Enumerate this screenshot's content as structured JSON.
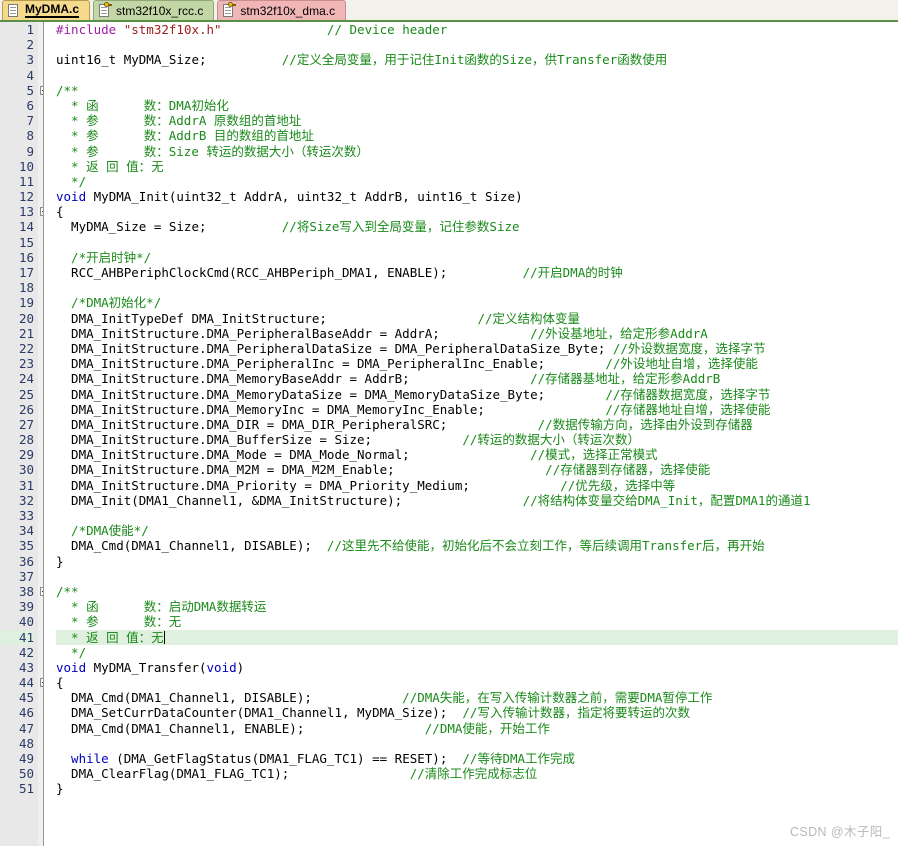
{
  "tabs": [
    {
      "label": "MyDMA.c",
      "state": "active",
      "icon": "document-icon"
    },
    {
      "label": "stm32f10x_rcc.c",
      "state": "green",
      "icon": "document-key-icon"
    },
    {
      "label": "stm32f10x_dma.c",
      "state": "pink",
      "icon": "document-key-icon"
    }
  ],
  "colors": {
    "active_tab": "#f5d98c",
    "green_tab": "#c3d6a6",
    "pink_tab": "#f0b5b5",
    "tabbar_rule": "#5a8f4a",
    "gutter_bg": "#e8e8e8",
    "line_number": "#2b3a67",
    "comment": "#1a8a1a",
    "keyword": "#0000c0",
    "preprocessor": "#a020a0",
    "string": "#a02020",
    "current_line": "#dff0df",
    "watermark": "#b9b9b9"
  },
  "editor": {
    "current_line": 41,
    "first_line": 1,
    "last_line": 51,
    "lines": [
      {
        "n": 1,
        "fold": "none",
        "tokens": [
          {
            "c": "t-pre",
            "s": "#include "
          },
          {
            "c": "t-str",
            "s": "\"stm32f10x.h\""
          },
          {
            "c": "t-cmt",
            "s": "              // Device header"
          }
        ]
      },
      {
        "n": 2,
        "fold": "none",
        "tokens": []
      },
      {
        "n": 3,
        "fold": "none",
        "tokens": [
          {
            "c": "t-txt",
            "s": "uint16_t MyDMA_Size;"
          },
          {
            "c": "t-cmt",
            "s": "          //定义全局变量，用于记住Init函数的Size，供Transfer函数使用"
          }
        ]
      },
      {
        "n": 4,
        "fold": "none",
        "tokens": []
      },
      {
        "n": 5,
        "fold": "start",
        "tokens": [
          {
            "c": "t-cmt",
            "s": "/**"
          }
        ]
      },
      {
        "n": 6,
        "fold": "bar",
        "tokens": [
          {
            "c": "t-cmt",
            "s": "  * 函      数：DMA初始化"
          }
        ]
      },
      {
        "n": 7,
        "fold": "bar",
        "tokens": [
          {
            "c": "t-cmt",
            "s": "  * 参      数：AddrA 原数组的首地址"
          }
        ]
      },
      {
        "n": 8,
        "fold": "bar",
        "tokens": [
          {
            "c": "t-cmt",
            "s": "  * 参      数：AddrB 目的数组的首地址"
          }
        ]
      },
      {
        "n": 9,
        "fold": "bar",
        "tokens": [
          {
            "c": "t-cmt",
            "s": "  * 参      数：Size 转运的数据大小（转运次数）"
          }
        ]
      },
      {
        "n": 10,
        "fold": "bar",
        "tokens": [
          {
            "c": "t-cmt",
            "s": "  * 返 回 值：无"
          }
        ]
      },
      {
        "n": 11,
        "fold": "end",
        "tokens": [
          {
            "c": "t-cmt",
            "s": "  */"
          }
        ]
      },
      {
        "n": 12,
        "fold": "none",
        "tokens": [
          {
            "c": "t-kw",
            "s": "void "
          },
          {
            "c": "t-txt",
            "s": "MyDMA_Init(uint32_t AddrA, uint32_t AddrB, uint16_t Size)"
          }
        ]
      },
      {
        "n": 13,
        "fold": "start",
        "tokens": [
          {
            "c": "t-txt",
            "s": "{"
          }
        ]
      },
      {
        "n": 14,
        "fold": "bar",
        "tokens": [
          {
            "c": "t-txt",
            "s": "  MyDMA_Size = Size;"
          },
          {
            "c": "t-cmt",
            "s": "          //将Size写入到全局变量，记住参数Size"
          }
        ]
      },
      {
        "n": 15,
        "fold": "bar",
        "tokens": []
      },
      {
        "n": 16,
        "fold": "bar",
        "tokens": [
          {
            "c": "t-cmt",
            "s": "  /*开启时钟*/"
          }
        ]
      },
      {
        "n": 17,
        "fold": "bar",
        "tokens": [
          {
            "c": "t-txt",
            "s": "  RCC_AHBPeriphClockCmd(RCC_AHBPeriph_DMA1, ENABLE);"
          },
          {
            "c": "t-cmt",
            "s": "          //开启DMA的时钟"
          }
        ]
      },
      {
        "n": 18,
        "fold": "bar",
        "tokens": []
      },
      {
        "n": 19,
        "fold": "bar",
        "tokens": [
          {
            "c": "t-cmt",
            "s": "  /*DMA初始化*/"
          }
        ]
      },
      {
        "n": 20,
        "fold": "bar",
        "tokens": [
          {
            "c": "t-txt",
            "s": "  DMA_InitTypeDef DMA_InitStructure;"
          },
          {
            "c": "t-cmt",
            "s": "                    //定义结构体变量"
          }
        ]
      },
      {
        "n": 21,
        "fold": "bar",
        "tokens": [
          {
            "c": "t-txt",
            "s": "  DMA_InitStructure.DMA_PeripheralBaseAddr = AddrA;"
          },
          {
            "c": "t-cmt",
            "s": "            //外设基地址，给定形参AddrA"
          }
        ]
      },
      {
        "n": 22,
        "fold": "bar",
        "tokens": [
          {
            "c": "t-txt",
            "s": "  DMA_InitStructure.DMA_PeripheralDataSize = DMA_PeripheralDataSize_Byte;"
          },
          {
            "c": "t-cmt",
            "s": " //外设数据宽度，选择字节"
          }
        ]
      },
      {
        "n": 23,
        "fold": "bar",
        "tokens": [
          {
            "c": "t-txt",
            "s": "  DMA_InitStructure.DMA_PeripheralInc = DMA_PeripheralInc_Enable;"
          },
          {
            "c": "t-cmt",
            "s": "        //外设地址自增，选择使能"
          }
        ]
      },
      {
        "n": 24,
        "fold": "bar",
        "tokens": [
          {
            "c": "t-txt",
            "s": "  DMA_InitStructure.DMA_MemoryBaseAddr = AddrB;"
          },
          {
            "c": "t-cmt",
            "s": "                //存储器基地址，给定形参AddrB"
          }
        ]
      },
      {
        "n": 25,
        "fold": "bar",
        "tokens": [
          {
            "c": "t-txt",
            "s": "  DMA_InitStructure.DMA_MemoryDataSize = DMA_MemoryDataSize_Byte;"
          },
          {
            "c": "t-cmt",
            "s": "        //存储器数据宽度，选择字节"
          }
        ]
      },
      {
        "n": 26,
        "fold": "bar",
        "tokens": [
          {
            "c": "t-txt",
            "s": "  DMA_InitStructure.DMA_MemoryInc = DMA_MemoryInc_Enable;"
          },
          {
            "c": "t-cmt",
            "s": "                //存储器地址自增，选择使能"
          }
        ]
      },
      {
        "n": 27,
        "fold": "bar",
        "tokens": [
          {
            "c": "t-txt",
            "s": "  DMA_InitStructure.DMA_DIR = DMA_DIR_PeripheralSRC;"
          },
          {
            "c": "t-cmt",
            "s": "            //数据传输方向，选择由外设到存储器"
          }
        ]
      },
      {
        "n": 28,
        "fold": "bar",
        "tokens": [
          {
            "c": "t-txt",
            "s": "  DMA_InitStructure.DMA_BufferSize = Size;"
          },
          {
            "c": "t-cmt",
            "s": "            //转运的数据大小（转运次数）"
          }
        ]
      },
      {
        "n": 29,
        "fold": "bar",
        "tokens": [
          {
            "c": "t-txt",
            "s": "  DMA_InitStructure.DMA_Mode = DMA_Mode_Normal;"
          },
          {
            "c": "t-cmt",
            "s": "                //模式，选择正常模式"
          }
        ]
      },
      {
        "n": 30,
        "fold": "bar",
        "tokens": [
          {
            "c": "t-txt",
            "s": "  DMA_InitStructure.DMA_M2M = DMA_M2M_Enable;"
          },
          {
            "c": "t-cmt",
            "s": "                    //存储器到存储器，选择使能"
          }
        ]
      },
      {
        "n": 31,
        "fold": "bar",
        "tokens": [
          {
            "c": "t-txt",
            "s": "  DMA_InitStructure.DMA_Priority = DMA_Priority_Medium;"
          },
          {
            "c": "t-cmt",
            "s": "            //优先级，选择中等"
          }
        ]
      },
      {
        "n": 32,
        "fold": "bar",
        "tokens": [
          {
            "c": "t-txt",
            "s": "  DMA_Init(DMA1_Channel1, &DMA_InitStructure);"
          },
          {
            "c": "t-cmt",
            "s": "                //将结构体变量交给DMA_Init，配置DMA1的通道1"
          }
        ]
      },
      {
        "n": 33,
        "fold": "bar",
        "tokens": []
      },
      {
        "n": 34,
        "fold": "bar",
        "tokens": [
          {
            "c": "t-cmt",
            "s": "  /*DMA使能*/"
          }
        ]
      },
      {
        "n": 35,
        "fold": "bar",
        "tokens": [
          {
            "c": "t-txt",
            "s": "  DMA_Cmd(DMA1_Channel1, DISABLE);"
          },
          {
            "c": "t-cmt",
            "s": "  //这里先不给使能，初始化后不会立刻工作，等后续调用Transfer后，再开始"
          }
        ]
      },
      {
        "n": 36,
        "fold": "end",
        "tokens": [
          {
            "c": "t-txt",
            "s": "}"
          }
        ]
      },
      {
        "n": 37,
        "fold": "none",
        "tokens": []
      },
      {
        "n": 38,
        "fold": "start",
        "tokens": [
          {
            "c": "t-cmt",
            "s": "/**"
          }
        ]
      },
      {
        "n": 39,
        "fold": "bar",
        "tokens": [
          {
            "c": "t-cmt",
            "s": "  * 函      数：启动DMA数据转运"
          }
        ]
      },
      {
        "n": 40,
        "fold": "bar",
        "tokens": [
          {
            "c": "t-cmt",
            "s": "  * 参      数：无"
          }
        ]
      },
      {
        "n": 41,
        "fold": "bar",
        "tokens": [
          {
            "c": "t-cmt",
            "s": "  * 返 回 值：无"
          }
        ],
        "caret": true
      },
      {
        "n": 42,
        "fold": "end",
        "tokens": [
          {
            "c": "t-cmt",
            "s": "  */"
          }
        ]
      },
      {
        "n": 43,
        "fold": "none",
        "tokens": [
          {
            "c": "t-kw",
            "s": "void "
          },
          {
            "c": "t-txt",
            "s": "MyDMA_Transfer("
          },
          {
            "c": "t-kw",
            "s": "void"
          },
          {
            "c": "t-txt",
            "s": ")"
          }
        ]
      },
      {
        "n": 44,
        "fold": "start",
        "tokens": [
          {
            "c": "t-txt",
            "s": "{"
          }
        ]
      },
      {
        "n": 45,
        "fold": "bar",
        "tokens": [
          {
            "c": "t-txt",
            "s": "  DMA_Cmd(DMA1_Channel1, DISABLE);"
          },
          {
            "c": "t-cmt",
            "s": "            //DMA失能，在写入传输计数器之前，需要DMA暂停工作"
          }
        ]
      },
      {
        "n": 46,
        "fold": "bar",
        "tokens": [
          {
            "c": "t-txt",
            "s": "  DMA_SetCurrDataCounter(DMA1_Channel1, MyDMA_Size);"
          },
          {
            "c": "t-cmt",
            "s": "  //写入传输计数器，指定将要转运的次数"
          }
        ]
      },
      {
        "n": 47,
        "fold": "bar",
        "tokens": [
          {
            "c": "t-txt",
            "s": "  DMA_Cmd(DMA1_Channel1, ENABLE);"
          },
          {
            "c": "t-cmt",
            "s": "                //DMA使能，开始工作"
          }
        ]
      },
      {
        "n": 48,
        "fold": "bar",
        "tokens": []
      },
      {
        "n": 49,
        "fold": "bar",
        "tokens": [
          {
            "c": "t-kw",
            "s": "  while "
          },
          {
            "c": "t-txt",
            "s": "(DMA_GetFlagStatus(DMA1_FLAG_TC1) == RESET);"
          },
          {
            "c": "t-cmt",
            "s": "  //等待DMA工作完成"
          }
        ]
      },
      {
        "n": 50,
        "fold": "bar",
        "tokens": [
          {
            "c": "t-txt",
            "s": "  DMA_ClearFlag(DMA1_FLAG_TC1);"
          },
          {
            "c": "t-cmt",
            "s": "                //清除工作完成标志位"
          }
        ]
      },
      {
        "n": 51,
        "fold": "end",
        "tokens": [
          {
            "c": "t-txt",
            "s": "}"
          }
        ]
      }
    ]
  },
  "watermark": {
    "text": "CSDN @木子阳_"
  }
}
